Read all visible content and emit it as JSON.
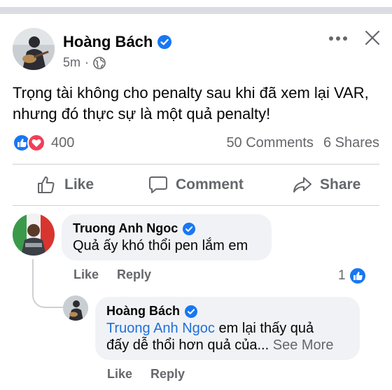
{
  "post": {
    "author": "Hoàng Bách",
    "time": "5m",
    "dot": "·",
    "text": "Trọng tài không cho penalty sau khi đã xem lại VAR, nhưng đó thực sự là một quả penalty!",
    "reactions_count": "400",
    "comments_count": "50 Comments",
    "shares_count": "6 Shares",
    "reaction_icons": [
      "like-icon",
      "love-icon"
    ],
    "privacy_icon": "globe-icon"
  },
  "actions": {
    "like": "Like",
    "comment": "Comment",
    "share": "Share"
  },
  "comments": [
    {
      "author": "Truong Anh Ngoc",
      "text": "Quả ấy khó thổi pen lắm em",
      "like": "Like",
      "reply": "Reply",
      "like_count": "1"
    }
  ],
  "reply": {
    "author": "Hoàng Bách",
    "mention": "Truong Anh Ngoc",
    "text_line1": " em lại thấy quả",
    "text_line2": "đấy dễ thổi hơn quả của...",
    "see_more": "See More",
    "like": "Like",
    "reply": "Reply"
  },
  "colors": {
    "brand_blue": "#1877f2",
    "love_red": "#f33e58",
    "text_secondary": "#65676b",
    "bubble_bg": "#f0f2f5"
  }
}
